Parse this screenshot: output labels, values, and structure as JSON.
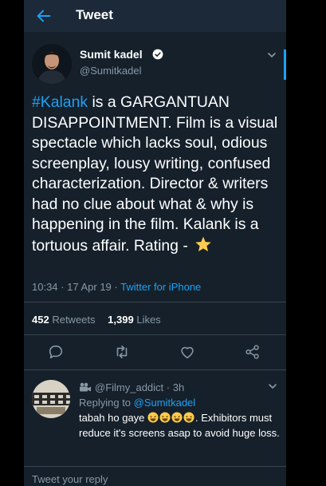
{
  "colors": {
    "background": "#15202b",
    "header": "#1c2938",
    "accent": "#1da1f2",
    "muted": "#8899a6",
    "divider": "#38444d",
    "star": "#ffcc4d"
  },
  "header": {
    "title": "Tweet",
    "back_icon": "back-arrow-icon"
  },
  "tweet": {
    "author_name": "Sumit kadel",
    "author_handle": "@Sumitkadel",
    "text_hashtag": "#Kalank",
    "text_body": " is a GARGANTUAN DISAPPOINTMENT. Film is a visual spectacle which lacks soul, odious screenplay, lousy writing, confused characterization. Director & writers had no clue about what & why is happening in the film. Kalank is a tortuous affair. Rating - ",
    "time": "10:34",
    "date": "17 Apr 19",
    "client": "Twitter for iPhone",
    "retweets": "452",
    "retweets_label": "Retweets",
    "likes": "1,399",
    "likes_label": "Likes",
    "actions": [
      "reply-icon",
      "retweet-icon",
      "like-icon",
      "share-icon"
    ]
  },
  "reply": {
    "handle": "@Filmy_addict",
    "time": "3h",
    "replying_to_label": "Replying to",
    "replying_to": "@Sumitkadel",
    "text_start": "tabah ho gaye ",
    "text_end": ". Exhibitors must reduce it's screens asap to avoid huge loss."
  },
  "compose": {
    "placeholder": "Tweet your reply"
  }
}
